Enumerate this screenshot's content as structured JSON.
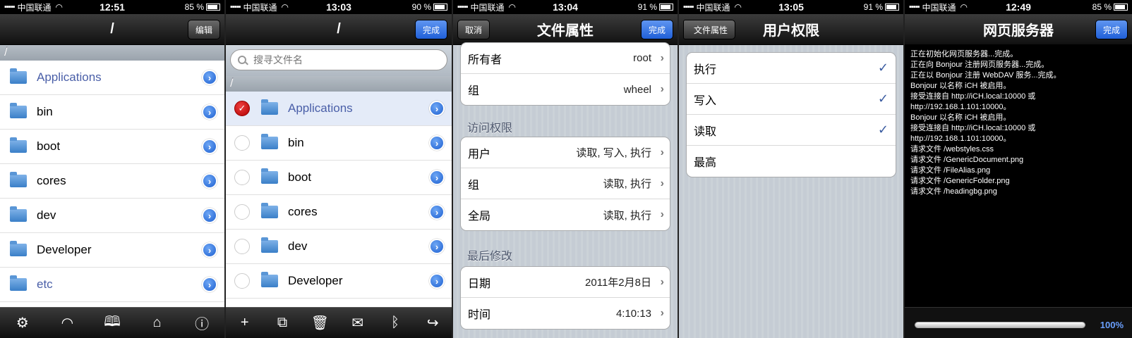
{
  "screen1": {
    "status": {
      "signal": "▪▪▪▪▪",
      "carrier": "中国联通",
      "time": "12:51",
      "battery": "85 %"
    },
    "nav": {
      "title": "/",
      "right_button": "编辑"
    },
    "path": "/",
    "files": [
      "Applications",
      "bin",
      "boot",
      "cores",
      "dev",
      "Developer",
      "etc"
    ],
    "toolbar_icons": [
      "gear-icon",
      "wifi-icon",
      "book-icon",
      "home-icon",
      "info-icon"
    ]
  },
  "screen2": {
    "status": {
      "signal": "▪▪▪▪▪",
      "carrier": "中国联通",
      "time": "13:03",
      "battery": "90 %"
    },
    "nav": {
      "title": "/",
      "right_button": "完成"
    },
    "search_placeholder": "搜寻文件名",
    "path": "/",
    "files": [
      "Applications",
      "bin",
      "boot",
      "cores",
      "dev",
      "Developer"
    ],
    "toolbar_icons": [
      "plus-icon",
      "copy-icon",
      "trash-icon",
      "mail-icon",
      "bluetooth-icon",
      "share-icon"
    ]
  },
  "screen3": {
    "status": {
      "signal": "▪▪▪▪▪",
      "carrier": "中国联通",
      "time": "13:04",
      "battery": "91 %"
    },
    "nav": {
      "title": "文件属性",
      "left_button": "取消",
      "right_button": "完成"
    },
    "owner_rows": [
      {
        "label": "所有者",
        "value": "root"
      },
      {
        "label": "组",
        "value": "wheel"
      }
    ],
    "access_section": "访问权限",
    "access_rows": [
      {
        "label": "用户",
        "value": "读取, 写入, 执行"
      },
      {
        "label": "组",
        "value": "读取, 执行"
      },
      {
        "label": "全局",
        "value": "读取, 执行"
      }
    ],
    "modified_section": "最后修改",
    "modified_rows": [
      {
        "label": "日期",
        "value": "2011年2月8日"
      },
      {
        "label": "时间",
        "value": "4:10:13"
      }
    ]
  },
  "screen4": {
    "status": {
      "signal": "▪▪▪▪▪",
      "carrier": "中国联通",
      "time": "13:05",
      "battery": "91 %"
    },
    "nav": {
      "title": "用户权限",
      "back_button": "文件属性"
    },
    "permissions": [
      {
        "label": "执行",
        "check": "✓"
      },
      {
        "label": "写入",
        "check": "✓"
      },
      {
        "label": "读取",
        "check": "✓"
      },
      {
        "label": "最高",
        "check": ""
      }
    ]
  },
  "screen5": {
    "status": {
      "signal": "▪▪▪▪▪",
      "carrier": "中国联通",
      "time": "12:49",
      "battery": "85 %"
    },
    "nav": {
      "title": "网页服务器",
      "right_button": "完成"
    },
    "log": [
      "正在初始化网页服务器...完成。",
      "正在向 Bonjour 注册网页服务器...完成。",
      "正在以 Bonjour 注册 WebDAV 服务...完成。",
      "Bonjour 以名称 iCH 被启用。",
      "接受连接自 http://iCH.local:10000 或",
      "http://192.168.1.101:10000。",
      "Bonjour 以名称 iCH 被启用。",
      "接受连接自 http://iCH.local:10000 或",
      "http://192.168.1.101:10000。",
      "请求文件 /webstyles.css",
      "请求文件 /GenericDocument.png",
      "请求文件 /FileAlias.png",
      "请求文件 /GenericFolder.png",
      "请求文件 /headingbg.png"
    ],
    "progress": 1.0,
    "progress_label": "100%"
  }
}
